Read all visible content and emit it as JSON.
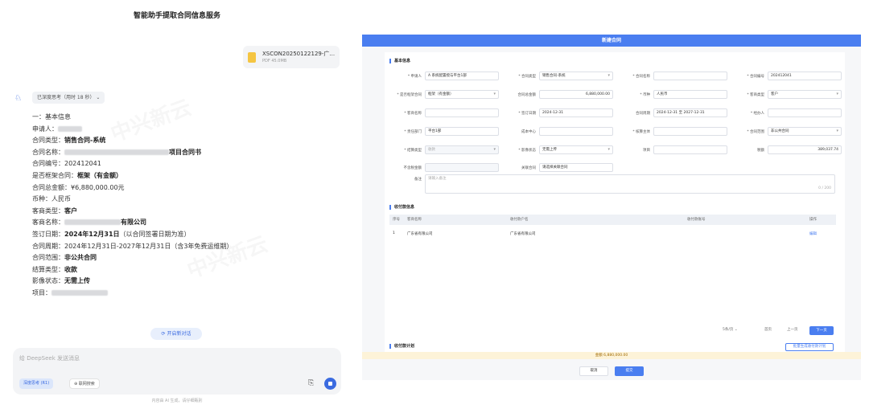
{
  "chat": {
    "title": "智能助手提取合同信息服务",
    "file": {
      "name": "XSCON20250122129-广...",
      "meta": "PDF 45.0MB"
    },
    "think_chip": "已深度思考（用时 18 秒）",
    "info_lines": [
      {
        "label": "一：基本信息",
        "value": ""
      },
      {
        "label": "申请人：",
        "value": ""
      },
      {
        "label": "合同类型：",
        "value": "销售合同-系统"
      },
      {
        "label": "合同名称：",
        "value": "项目合同书"
      },
      {
        "label": "合同编号：",
        "value": "202412041"
      },
      {
        "label": "是否框架合同：",
        "value": "框架（有金额）"
      },
      {
        "label": "合同总金额：",
        "value": "¥6,880,000.00元"
      },
      {
        "label": "币种：",
        "value": "人民币"
      },
      {
        "label": "客商类型：",
        "value": "客户"
      },
      {
        "label": "客商名称：",
        "value": "有限公司"
      },
      {
        "label": "签订日期：",
        "value": "2024年12月31日",
        "note": "（以合同签署日期为准）"
      },
      {
        "label": "合同周期：",
        "value": "2024年12月31日-2027年12月31日（含3年免费运维期）"
      },
      {
        "label": "合同范围：",
        "value": "非公共合同"
      },
      {
        "label": "结算类型：",
        "value": "收款"
      },
      {
        "label": "影像状态：",
        "value": "无需上传"
      },
      {
        "label": "项目：",
        "value": ""
      }
    ],
    "new_chat": "开启新对话",
    "input_placeholder": "给 DeepSeek 发送消息",
    "chip_deep": "深度思考 (R1)",
    "chip_web": "联网搜索",
    "disclaimer": "内容由 AI 生成，请仔细甄别",
    "watermark": "中兴新云"
  },
  "form": {
    "header": "新建合同",
    "section_basic": "基本信息",
    "fields": [
      {
        "label": "* 申请人",
        "value": "A 系统配置授与平台1部"
      },
      {
        "label": "* 合同类型",
        "value": "销售合同-系统"
      },
      {
        "label": "* 合同名称",
        "value": ""
      },
      {
        "label": "* 合同编号",
        "value": "202412041"
      },
      {
        "label": "* 是否框架合同",
        "value": "框架（有金额）"
      },
      {
        "label": "合同总金额",
        "value": "6,880,000.00"
      },
      {
        "label": "* 币种",
        "value": "人民币"
      },
      {
        "label": "* 客商类型",
        "value": "客户"
      },
      {
        "label": "* 客商名称",
        "value": ""
      },
      {
        "label": "* 签订日期",
        "value": "2024-12-31"
      },
      {
        "label": "合同周期",
        "value": "2024-12-31 至 2027-12-31"
      },
      {
        "label": "* 经办人",
        "value": ""
      },
      {
        "label": "* 责任部门",
        "value": "平台1部"
      },
      {
        "label": "成本中心",
        "value": ""
      },
      {
        "label": "* 核算主体",
        "value": ""
      },
      {
        "label": "* 合同范围",
        "value": "非公共合同"
      },
      {
        "label": "* 结算类型",
        "value": "收款"
      },
      {
        "label": "* 影像状态",
        "value": "无需上传"
      },
      {
        "label": "项目",
        "value": ""
      },
      {
        "label": "税额",
        "value": "389,037.74"
      },
      {
        "label": "不含税金额",
        "value": ""
      },
      {
        "label": "关联合同",
        "value": "请选择关联合同"
      }
    ],
    "remark_label": "备注",
    "remark_placeholder": "请输入备注",
    "remark_count": "0 / 200",
    "section_party": "收付款信息",
    "table_headers": [
      "序号",
      "客商名称",
      "收付款户名",
      "收付款账号",
      "操作"
    ],
    "table_rows": [
      {
        "idx": "1",
        "name": "广东省有限公司",
        "account_name": "广东省有限公司",
        "account_no": "",
        "op": "编辑"
      }
    ],
    "pager_size": "5条/页",
    "pager_prev": "首页",
    "pager_prev2": "上一页",
    "pager_next": "下一页",
    "section_plan": "收付款计划",
    "plan_btn": "批量生成收付款计划",
    "total": "金额 6,880,000.00",
    "btn_cancel": "取消",
    "btn_submit": "提交"
  }
}
